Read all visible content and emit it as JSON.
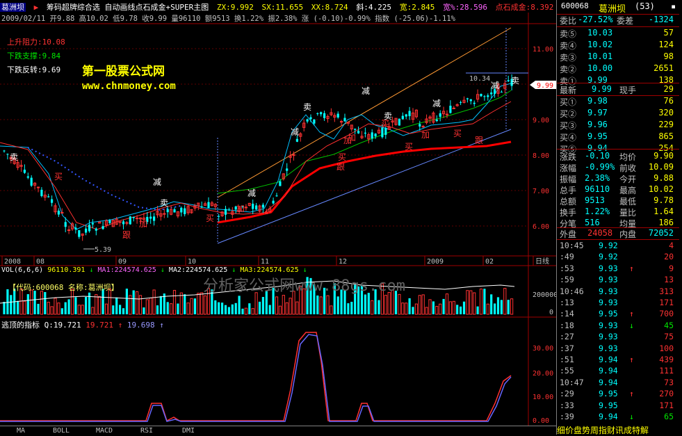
{
  "stock": {
    "name": "葛洲坝",
    "code": "600068",
    "period_count": "(53)"
  },
  "topbar": {
    "indicator_names": "筹码超牌综合选  自动画线点石成金+SUPER主图",
    "zx": "ZX:9.992",
    "sx": "SX:11.655",
    "xx": "XX:8.724",
    "slope": "斜:4.225",
    "width": "宽:2.845",
    "width_pct": "宽%:28.596",
    "label_dscj": "点石成金:8.392"
  },
  "ohlc": {
    "date": "2009/02/11",
    "open": "开9.88",
    "high": "高10.02",
    "low": "低9.78",
    "close": "收9.99",
    "vol": "量96110",
    "amount": "额9513",
    "turnover": "换1.22%",
    "amplitude": "振2.38%",
    "change": "涨 (-0.10)-0.99%",
    "index": "指数 (-25.06)-1.11%"
  },
  "annotations": {
    "resistance": "上升阻力:10.08",
    "support": "下跌支撑:9.84",
    "reversal": "下跌反转:9.69",
    "site_title": "第一股票公式网",
    "site_url": "www.chnmoney.com",
    "bg_watermark": "分析家公式网www.88gs.com",
    "high_label": "10.34",
    "low_label": "5.39",
    "current_price_tag": "9.99"
  },
  "signals": [
    "卖",
    "买",
    "卖",
    "减",
    "加",
    "买",
    "减",
    "加",
    "卖",
    "减",
    "加",
    "买",
    "跟",
    "减",
    "加",
    "买",
    "减",
    "卖",
    "买",
    "跟",
    "减",
    "卖",
    "买",
    "加",
    "跟"
  ],
  "price_axis": [
    "11.00",
    "10.00",
    "9.00",
    "8.00",
    "7.00",
    "6.00"
  ],
  "date_axis": [
    "2008",
    "08",
    "09",
    "10",
    "11",
    "12",
    "2009",
    "02",
    "日线"
  ],
  "volume_panel": {
    "header_vol": "VOL(6,6,6)",
    "vol_val": "96110.391",
    "ma1": "MA1:224574.625",
    "ma2": "MA2:224574.625",
    "ma3": "MA3:224574.625",
    "code_label": "【代码:600068 名称:葛洲坝】",
    "axis": [
      "200000",
      "0"
    ]
  },
  "indicator_panel": {
    "title": "逃顶的指标",
    "q": "Q:19.721",
    "v2": "19.721",
    "v3": "19.698",
    "axis": [
      "30.00",
      "20.00",
      "10.00",
      "0.00"
    ]
  },
  "tabs": [
    "MA",
    "BOLL",
    "MACD",
    "RSI",
    "DMI"
  ],
  "quote": {
    "webi_label": "委比",
    "webi": "-27.52%",
    "wecha_label": "委差",
    "wecha": "-1324",
    "asks": [
      {
        "label": "卖⑤",
        "price": "10.03",
        "vol": "57"
      },
      {
        "label": "卖④",
        "price": "10.02",
        "vol": "124"
      },
      {
        "label": "卖③",
        "price": "10.01",
        "vol": "98"
      },
      {
        "label": "卖②",
        "price": "10.00",
        "vol": "2651"
      },
      {
        "label": "卖①",
        "price": "9.99",
        "vol": "138"
      }
    ],
    "latest_label": "最新",
    "latest": "9.99",
    "now_hand_label": "现手",
    "now_hand": "29",
    "bids": [
      {
        "label": "买①",
        "price": "9.98",
        "vol": "76"
      },
      {
        "label": "买②",
        "price": "9.97",
        "vol": "320"
      },
      {
        "label": "买③",
        "price": "9.96",
        "vol": "229"
      },
      {
        "label": "买④",
        "price": "9.95",
        "vol": "865"
      },
      {
        "label": "买⑤",
        "price": "9.94",
        "vol": "254"
      }
    ],
    "stats": [
      {
        "l1": "涨跌",
        "v1": "-0.10",
        "l2": "均价",
        "v2": "9.90"
      },
      {
        "l1": "涨幅",
        "v1": "-0.99%",
        "l2": "前收",
        "v2": "10.09"
      },
      {
        "l1": "振幅",
        "v1": "2.38%",
        "l2": "今开",
        "v2": "9.88"
      },
      {
        "l1": "总手",
        "v1": "96110",
        "l2": "最高",
        "v2": "10.02"
      },
      {
        "l1": "总额",
        "v1": "9513",
        "l2": "最低",
        "v2": "9.78"
      },
      {
        "l1": "换手",
        "v1": "1.22%",
        "l2": "量比",
        "v2": "1.64"
      },
      {
        "l1": "分笔",
        "v1": "516",
        "l2": "均量",
        "v2": "186"
      }
    ],
    "outer_label": "外盘",
    "outer": "24058",
    "inner_label": "内盘",
    "inner": "72052"
  },
  "ticks": [
    {
      "t": "10:45",
      "p": "9.92",
      "d": "",
      "v": "4"
    },
    {
      "t": ":49",
      "p": "9.92",
      "d": "",
      "v": "20"
    },
    {
      "t": ":53",
      "p": "9.93",
      "d": "up",
      "v": "9"
    },
    {
      "t": ":59",
      "p": "9.93",
      "d": "",
      "v": "13"
    },
    {
      "t": "10:46",
      "p": "9.93",
      "d": "",
      "v": "313"
    },
    {
      "t": ":13",
      "p": "9.93",
      "d": "",
      "v": "171"
    },
    {
      "t": ":14",
      "p": "9.95",
      "d": "up",
      "v": "700"
    },
    {
      "t": ":18",
      "p": "9.93",
      "d": "down",
      "v": "45"
    },
    {
      "t": ":27",
      "p": "9.93",
      "d": "",
      "v": "75"
    },
    {
      "t": ":37",
      "p": "9.93",
      "d": "",
      "v": "100"
    },
    {
      "t": ":51",
      "p": "9.94",
      "d": "up",
      "v": "439"
    },
    {
      "t": ":55",
      "p": "9.94",
      "d": "",
      "v": "111"
    },
    {
      "t": "10:47",
      "p": "9.94",
      "d": "",
      "v": "73"
    },
    {
      "t": ":29",
      "p": "9.95",
      "d": "up",
      "v": "270"
    },
    {
      "t": ":33",
      "p": "9.95",
      "d": "",
      "v": "171"
    },
    {
      "t": ":39",
      "p": "9.94",
      "d": "down",
      "v": "65"
    }
  ],
  "bottom_tabs": "细价盘势周指财讯成特解",
  "colors": {
    "up": "#ff3232",
    "down": "#00ffff",
    "bg": "#000000",
    "grid": "#a00000"
  }
}
